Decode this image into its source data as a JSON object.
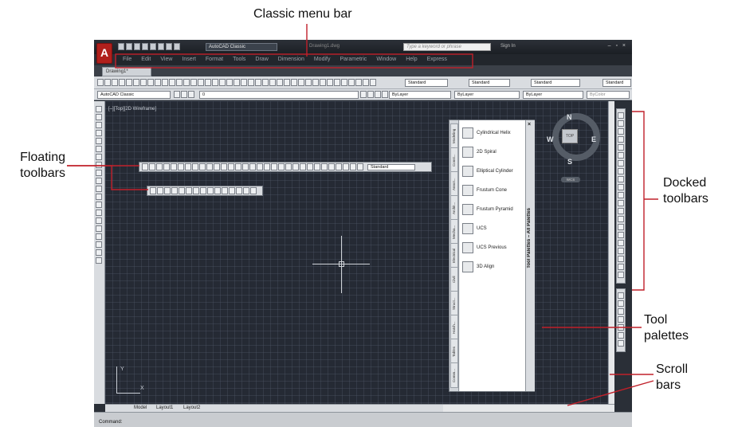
{
  "callouts": {
    "menu_bar": "Classic menu bar",
    "floating_1": "Floating",
    "floating_2": "toolbars",
    "docked_1": "Docked",
    "docked_2": "toolbars",
    "tool_1": "Tool",
    "tool_2": "palettes",
    "scroll_1": "Scroll",
    "scroll_2": "bars"
  },
  "window": {
    "app_letter": "A",
    "workspace": "AutoCAD Classic",
    "doc_title": "Drawing1.dwg",
    "search_placeholder": "Type a keyword or phrase",
    "sign_in": "Sign In",
    "window_controls": "– ▫ ×"
  },
  "menu": [
    "File",
    "Edit",
    "View",
    "Insert",
    "Format",
    "Tools",
    "Draw",
    "Dimension",
    "Modify",
    "Parametric",
    "Window",
    "Help",
    "Express"
  ],
  "tabs": {
    "drawing": "Drawing1*"
  },
  "toolbar": {
    "text_style": "Standard",
    "dim_style": "Standard",
    "table_style": "Standard",
    "ml_style": "Standard",
    "workspace2": "AutoCAD Classic",
    "layer": "0",
    "color": "ByLayer",
    "linetype": "ByLayer",
    "lineweight": "ByLayer",
    "plotstyle": "ByColor"
  },
  "viewport_label": "[–][Top][2D Wireframe]",
  "floating_toolbar": {
    "dim_style": "Standard"
  },
  "compass": {
    "n": "N",
    "s": "S",
    "e": "E",
    "w": "W",
    "cube": "TOP",
    "wcs": "WCS"
  },
  "palette": {
    "title": "Tool Palettes – All Palettes",
    "tabs": [
      "Modeling",
      "Const...",
      "Annot...",
      "Archit...",
      "Mecha...",
      "Electrical",
      "Civil",
      "Struct...",
      "Hatch...",
      "Tables",
      "Comm..."
    ],
    "items": [
      "Cylindrical Helix",
      "2D Spiral",
      "Elliptical Cylinder",
      "Frustum Cone",
      "Frustum Pyramid",
      "UCS",
      "UCS Previous",
      "3D Align"
    ]
  },
  "ucs": {
    "x": "X",
    "y": "Y"
  },
  "layout_tabs": [
    "Model",
    "Layout1",
    "Layout2"
  ],
  "command": "Command:",
  "colors": {
    "canvas": "#252a34",
    "app_red": "#b0201c",
    "callout_line": "#c0202a"
  }
}
